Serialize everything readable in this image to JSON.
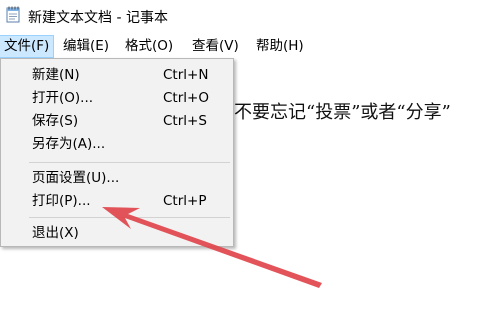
{
  "window": {
    "title": "新建文本文档 - 记事本"
  },
  "menubar": {
    "items": [
      {
        "label": "文件(F)",
        "active": true
      },
      {
        "label": "编辑(E)"
      },
      {
        "label": "格式(O)"
      },
      {
        "label": "查看(V)"
      },
      {
        "label": "帮助(H)"
      }
    ]
  },
  "file_menu": {
    "items": [
      {
        "label": "新建(N)",
        "shortcut": "Ctrl+N"
      },
      {
        "label": "打开(O)...",
        "shortcut": "Ctrl+O"
      },
      {
        "label": "保存(S)",
        "shortcut": "Ctrl+S"
      },
      {
        "label": "另存为(A)...",
        "shortcut": ""
      },
      {
        "label": "页面设置(U)...",
        "shortcut": ""
      },
      {
        "label": "打印(P)...",
        "shortcut": "Ctrl+P"
      },
      {
        "label": "退出(X)",
        "shortcut": ""
      }
    ]
  },
  "editor": {
    "text": "不要忘记“投票”或者“分享”"
  },
  "colors": {
    "menu_active_bg": "#cce8ff",
    "menu_active_border": "#99d1ff",
    "dropdown_bg": "#f2f2f2",
    "annotation_arrow": "#e0474c"
  },
  "icons": {
    "app_icon": "notepad-icon"
  }
}
